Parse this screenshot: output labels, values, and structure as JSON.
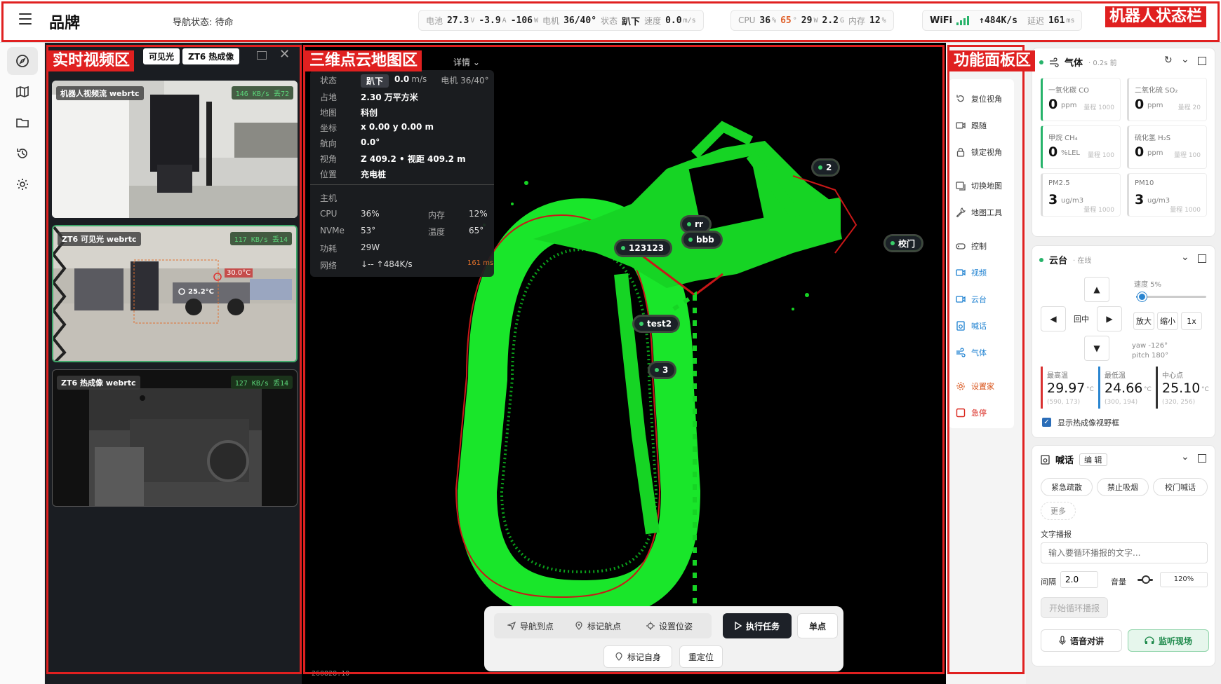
{
  "topbar": {
    "brand": "品牌",
    "nav_status": "导航状态: 待命",
    "battery_label": "电池",
    "battery_v": "27.3",
    "battery_v_unit": "V",
    "battery_a": "-3.9",
    "battery_a_unit": "A",
    "battery_w": "-106",
    "battery_w_unit": "W",
    "motor_label": "电机",
    "motor_val": "36/40°",
    "state_label": "状态",
    "state_val": "趴下",
    "speed_label": "速度",
    "speed_val": "0.0",
    "speed_unit": "m/s",
    "cpu_label": "CPU",
    "cpu_val": "36",
    "cpu_unit": "%",
    "cpu_temp": "65",
    "cpu_temp_unit": "°",
    "power_val": "29",
    "power_unit": "W",
    "mem_gb": "2.2",
    "mem_gb_unit": "G",
    "mem_label": "内存",
    "mem_val": "12",
    "mem_unit": "%",
    "wifi_label": "WiFi",
    "wifi_rate": "↑484K/s",
    "latency_label": "延迟",
    "latency_val": "161",
    "latency_unit": "ms"
  },
  "regions": {
    "status": "机器人状态栏",
    "video": "实时视频区",
    "map": "三维点云地图区",
    "func": "功能面板区"
  },
  "video": {
    "tabs": [
      "可见光",
      "ZT6 热成像"
    ],
    "cards": [
      {
        "label": "机器人视频流 webrtc",
        "rate": "146 KB/s 丢72"
      },
      {
        "label": "ZT6 可见光 webrtc",
        "rate": "117 KB/s 丢14",
        "temp_hi": "30.0°C",
        "temp_center": "25.2°C"
      },
      {
        "label": "ZT6 热成像 webrtc",
        "rate": "127 KB/s 丢14"
      }
    ]
  },
  "map": {
    "detail": "详情",
    "info": {
      "status_k": "状态",
      "status_v": "趴下",
      "speed_v": "0.0",
      "speed_u": "m/s",
      "motor_v": "电机 36/40°",
      "area_k": "占地",
      "area_v": "2.30 万平方米",
      "map_k": "地图",
      "map_v": "科创",
      "coord_k": "坐标",
      "coord_v": "x 0.00  y 0.00 m",
      "heading_k": "航向",
      "heading_v": "0.0°",
      "view_k": "视角",
      "view_v": "Z 409.2  •  视距 409.2 m",
      "pos_k": "位置",
      "pos_v": "充电桩",
      "host": "主机",
      "cpu_k": "CPU",
      "cpu_v": "36%",
      "mem_k": "内存",
      "mem_v": "12%",
      "nvme_k": "NVMe",
      "nvme_v": "53°",
      "temp_k": "温度",
      "temp_v": "65°",
      "pw_k": "功耗",
      "pw_v": "29W",
      "net_k": "网络",
      "net_v": "↓--   ↑484K/s",
      "net_ms": "161 ms"
    },
    "markers": [
      "2",
      "rr",
      "bbb",
      "123123",
      "校门",
      "test2",
      "3"
    ],
    "version": "260828.10",
    "bottom": {
      "nav_to": "导航到点",
      "mark_nav": "标记航点",
      "set_pose": "设置位姿",
      "exec": "执行任务",
      "single": "单点",
      "mark_self": "标记自身",
      "relocate": "重定位"
    }
  },
  "func": {
    "items": [
      "复位视角",
      "跟随",
      "锁定视角",
      "切换地图",
      "地图工具",
      "控制",
      "视频",
      "云台",
      "喊话",
      "气体",
      "设置家",
      "急停"
    ]
  },
  "gas": {
    "title": "气体",
    "ago": "· 0.2s 前",
    "items": [
      {
        "name": "一氧化碳 CO",
        "value": "0",
        "unit": "ppm",
        "range": "量程 1000"
      },
      {
        "name": "二氧化硫 SO₂",
        "value": "0",
        "unit": "ppm",
        "range": "量程 20"
      },
      {
        "name": "甲烷 CH₄",
        "value": "0",
        "unit": "%LEL",
        "range": "量程 100"
      },
      {
        "name": "硫化氢 H₂S",
        "value": "0",
        "unit": "ppm",
        "range": "量程 100"
      },
      {
        "name": "PM2.5",
        "value": "3",
        "unit": "ug/m3",
        "range": "量程 1000"
      },
      {
        "name": "PM10",
        "value": "3",
        "unit": "ug/m3",
        "range": "量程 1000"
      }
    ]
  },
  "ptz": {
    "title": "云台",
    "online": "· 在线",
    "speed": "速度 5%",
    "speed_fraction": 0.05,
    "center": "回中",
    "zoom_in": "放大",
    "zoom_out": "缩小",
    "zoom": "1x",
    "yaw": "yaw -126°",
    "pitch": "pitch 180°",
    "max_k": "最高温",
    "max_v": "29.97",
    "max_xy": "(590, 173)",
    "min_k": "最低温",
    "min_v": "24.66",
    "min_xy": "(300, 194)",
    "mid_k": "中心点",
    "mid_v": "25.10",
    "mid_xy": "(320, 256)",
    "unit": "°C",
    "show_fov": "显示热成像视野框"
  },
  "speak": {
    "title": "喊话",
    "edit": "编 辑",
    "chips": [
      "紧急疏散",
      "禁止吸烟",
      "校门喊话"
    ],
    "more": "更多",
    "tts_label": "文字播报",
    "tts_placeholder": "输入要循环播报的文字...",
    "interval_k": "间隔",
    "interval_v": "2.0",
    "volume_k": "音量",
    "volume_v": "120%",
    "volume_fraction": 0.55,
    "start_loop": "开始循环播报",
    "talk": "语音对讲",
    "listen": "监听现场"
  }
}
